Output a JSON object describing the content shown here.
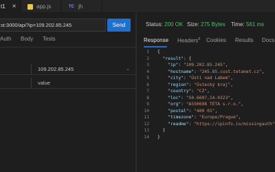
{
  "tabs": [
    {
      "label": "t1",
      "close": "×"
    },
    {
      "label": "app.js",
      "badge": "JS"
    },
    {
      "label": "jh",
      "badge": "TC"
    }
  ],
  "request": {
    "url": "st:3000/api?ip=109.202.85.245",
    "send_label": "Send",
    "tabs": [
      "Auth",
      "Body",
      "Tests"
    ],
    "params": [
      {
        "key": "",
        "value": "109.202.85.245"
      },
      {
        "key": "",
        "value": "value"
      }
    ]
  },
  "response": {
    "status_label": "Status:",
    "status_value": "200 OK",
    "size_label": "Size:",
    "size_value": "275 Bytes",
    "time_label": "Time:",
    "time_value": "561 ms",
    "tabs": [
      "Response",
      "Headers",
      "Cookies",
      "Results",
      "Docs"
    ],
    "headers_count": "6",
    "lines": [
      {
        "n": "1",
        "indent": "",
        "open": "{"
      },
      {
        "n": "2",
        "indent": "  ",
        "key": "\"result\"",
        "open": "{"
      },
      {
        "n": "3",
        "indent": "    ",
        "key": "\"ip\"",
        "value": "\"109.202.85.245\""
      },
      {
        "n": "4",
        "indent": "    ",
        "key": "\"hostname\"",
        "value": "\"245.85.cust.tetanet.cz\""
      },
      {
        "n": "5",
        "indent": "    ",
        "key": "\"city\"",
        "value": "\"Ústí nad Labem\""
      },
      {
        "n": "6",
        "indent": "    ",
        "key": "\"region\"",
        "value": "\"Ústecký kraj\""
      },
      {
        "n": "7",
        "indent": "    ",
        "key": "\"country\"",
        "value": "\"CZ\""
      },
      {
        "n": "8",
        "indent": "    ",
        "key": "\"loc\"",
        "value": "\"50.6607,14.0323\""
      },
      {
        "n": "9",
        "indent": "    ",
        "key": "\"org\"",
        "value": "\"AS50698 TETA s.r.o.\""
      },
      {
        "n": "10",
        "indent": "    ",
        "key": "\"postal\"",
        "value": "\"400 01\""
      },
      {
        "n": "11",
        "indent": "    ",
        "key": "\"timezone\"",
        "value": "\"Europe/Prague\""
      },
      {
        "n": "12",
        "indent": "    ",
        "key": "\"readme\"",
        "value": "\"https://ipinfo.io/missingauth\""
      },
      {
        "n": "13",
        "indent": "  ",
        "close": "}"
      },
      {
        "n": "14",
        "indent": "",
        "close": "}"
      }
    ]
  }
}
